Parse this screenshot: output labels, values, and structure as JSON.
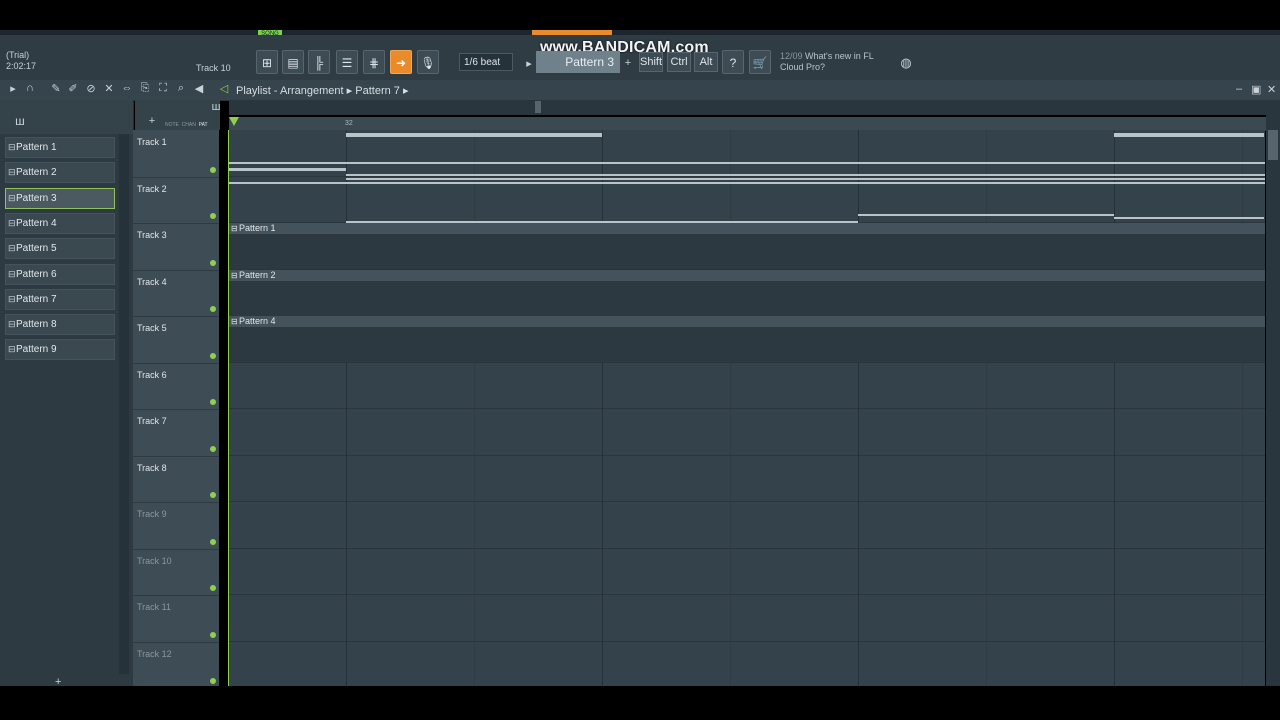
{
  "hint": {
    "line1": "(Trial)",
    "line2": "2:02:17",
    "track": "Track 10"
  },
  "watermark": "www.BANDICAM.com",
  "song_label": "SONG",
  "transport": {
    "snap": "1/6 beat",
    "pattern": "Pattern 3",
    "plus": "+"
  },
  "modifiers": [
    "Shift",
    "Ctrl",
    "Alt"
  ],
  "news": {
    "date": "12/09",
    "text1": "What's new in FL",
    "text2": "Cloud Pro?"
  },
  "breadcrumb": {
    "title": "Playlist - Arrangement",
    "sep": "▸",
    "pattern": "Pattern 7",
    "sep2": "▸"
  },
  "patterns": [
    "Pattern 1",
    "Pattern 2",
    "Pattern 3",
    "Pattern 4",
    "Pattern 5",
    "Pattern 6",
    "Pattern 7",
    "Pattern 8",
    "Pattern 9"
  ],
  "selected_pattern": "Pattern 3",
  "tracks": [
    "Track 1",
    "Track 2",
    "Track 3",
    "Track 4",
    "Track 5",
    "Track 6",
    "Track 7",
    "Track 8",
    "Track 9",
    "Track 10",
    "Track 11",
    "Track 12"
  ],
  "tab_labels": [
    "NOTE",
    "CHAN",
    "PAT"
  ],
  "ruler": {
    "bar_label": "32"
  },
  "clips": [
    {
      "track": "Track 3",
      "name": "Pattern 1"
    },
    {
      "track": "Track 4",
      "name": "Pattern 2"
    },
    {
      "track": "Track 5",
      "name": "Pattern 4"
    }
  ],
  "colors": {
    "accent": "#e98a2b",
    "active_green": "#8fd14f",
    "grid": "#34434b"
  }
}
